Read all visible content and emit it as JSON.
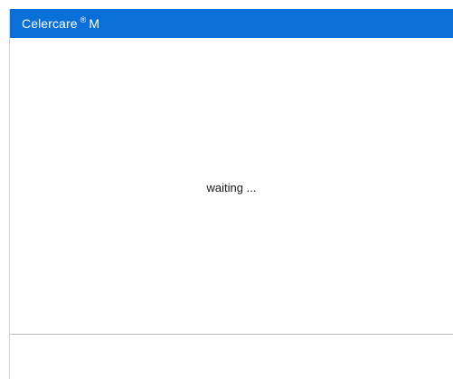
{
  "app": {
    "title_name": "Celercare",
    "title_mark": "®",
    "title_model": "M",
    "brand_color": "#0a6fd6"
  },
  "main": {
    "status_text": "waiting ..."
  }
}
